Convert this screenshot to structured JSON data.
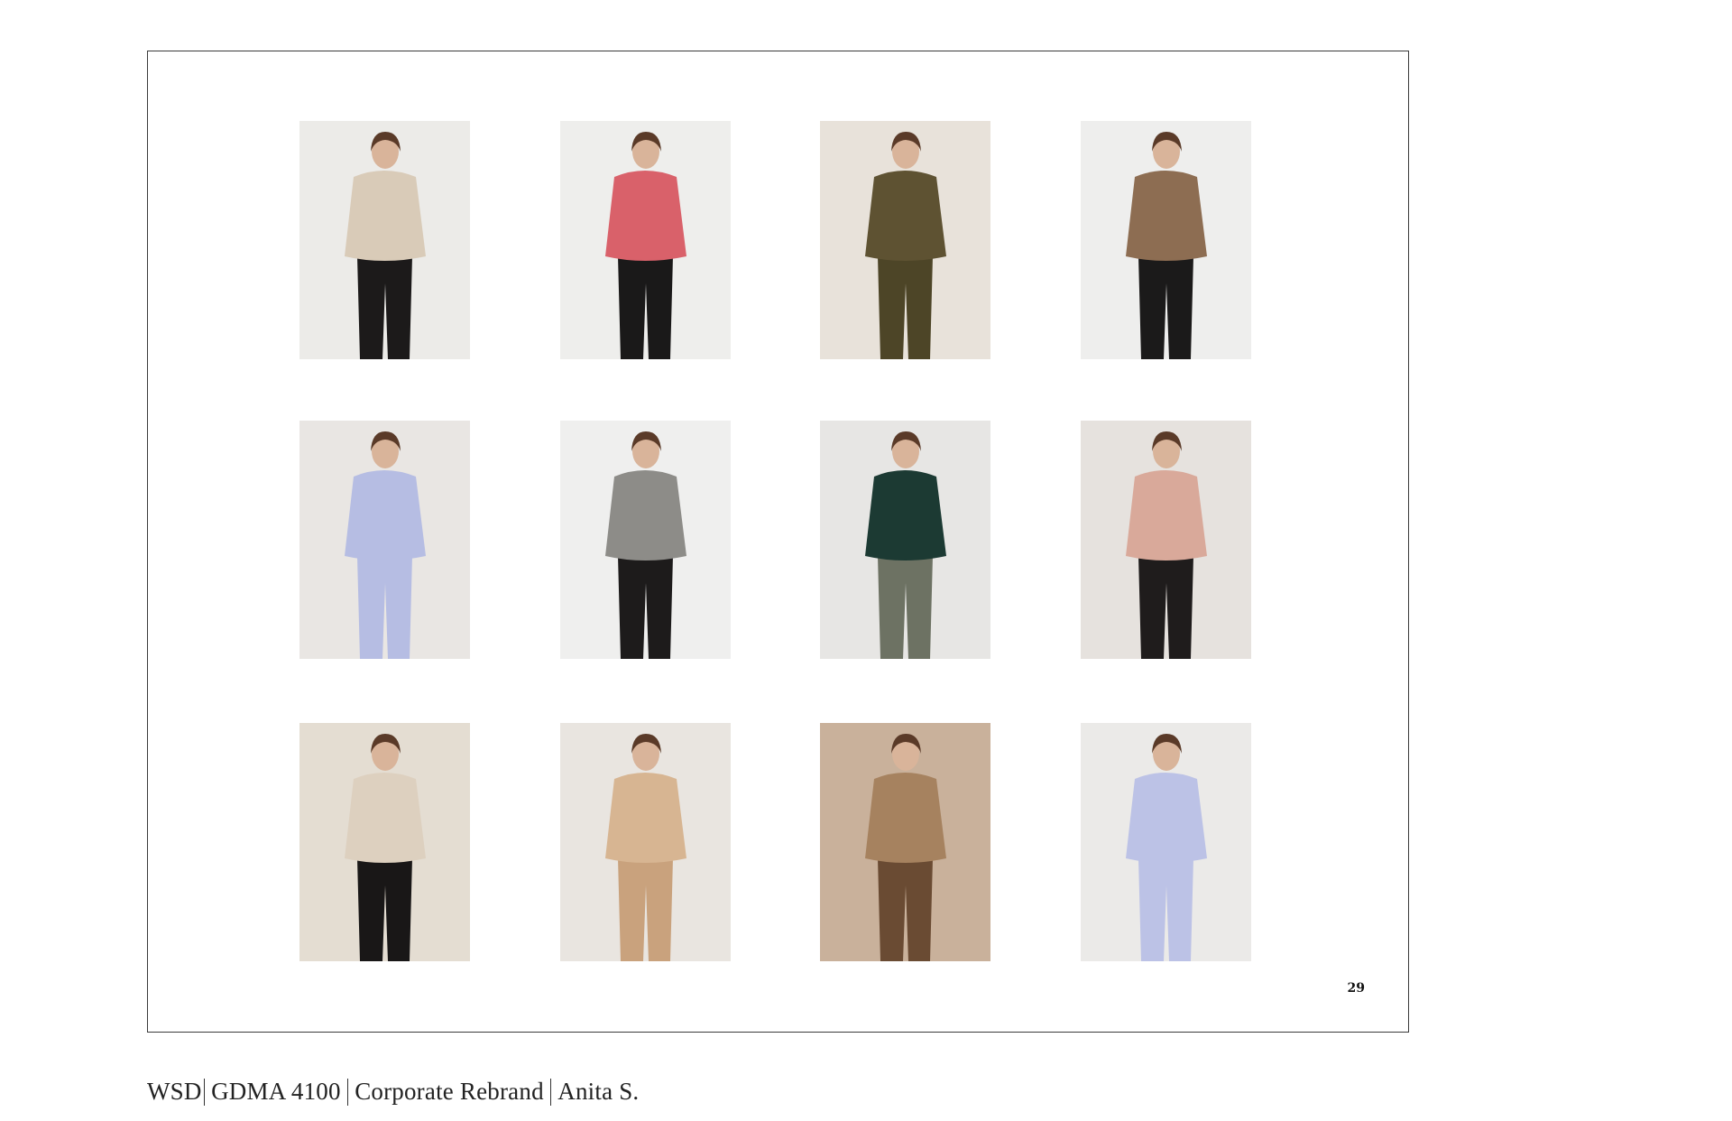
{
  "page": {
    "number": "29"
  },
  "footer": {
    "parts": [
      "WSD",
      "GDMA 4100",
      "Corporate Rebrand",
      "Anita S."
    ]
  },
  "photos": [
    {
      "name": "photo-model-cream-blouse-black-trousers",
      "bg": "#ecebe8",
      "top": "#d9cbb8",
      "bottom": "#1c1a1a"
    },
    {
      "name": "photo-model-striped-sweater-crouching",
      "bg": "#eeeeec",
      "top": "#d9616a",
      "bottom": "#1a1919"
    },
    {
      "name": "photo-model-olive-trench-coat",
      "bg": "#e8e2da",
      "top": "#5e5232",
      "bottom": "#4d4527"
    },
    {
      "name": "photo-model-camel-teddy-coat",
      "bg": "#eeeeed",
      "top": "#8d6d52",
      "bottom": "#1b1a1a"
    },
    {
      "name": "photo-model-lavender-turtleneck",
      "bg": "#e9e6e3",
      "top": "#b6bde3",
      "bottom": "#b6bde3"
    },
    {
      "name": "photo-model-plaid-blazer",
      "bg": "#efefee",
      "top": "#8d8c88",
      "bottom": "#1d1b1b"
    },
    {
      "name": "photo-model-green-sweater-pleated-skirt",
      "bg": "#e7e6e4",
      "top": "#1c3a33",
      "bottom": "#6d7263"
    },
    {
      "name": "photo-model-pink-teddy-coat",
      "bg": "#e6e2de",
      "top": "#d9a99a",
      "bottom": "#1f1c1c"
    },
    {
      "name": "photo-detail-tie-waist-trousers",
      "bg": "#e4ddd2",
      "top": "#ddd0bf",
      "bottom": "#191717"
    },
    {
      "name": "photo-model-lying-cable-knit",
      "bg": "#e9e5e0",
      "top": "#d7b592",
      "bottom": "#c9a27d"
    },
    {
      "name": "photo-model-beanie-scarf",
      "bg": "#c9b19b",
      "top": "#a6825f",
      "bottom": "#6a4b33"
    },
    {
      "name": "photo-model-lavender-sweater-hand-up",
      "bg": "#ebeae8",
      "top": "#bcc2e6",
      "bottom": "#bcc2e6"
    }
  ]
}
